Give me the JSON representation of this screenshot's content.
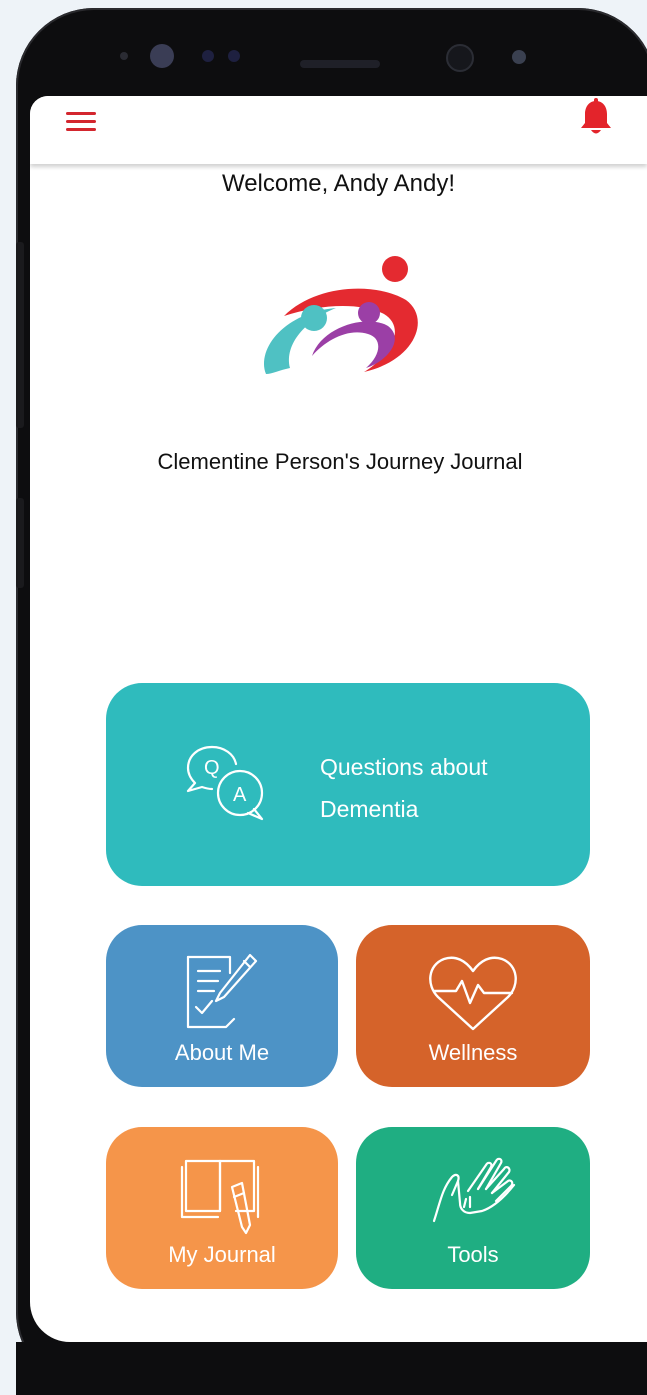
{
  "header": {
    "menu_icon": "hamburger-menu-icon",
    "notification_icon": "bell-icon",
    "accent_color": "#d3262e"
  },
  "welcome": {
    "text": "Welcome, Andy Andy!"
  },
  "logo": {
    "icon": "family-logo-icon",
    "colors": [
      "#e42a30",
      "#9b3fa6",
      "#4fc1c3"
    ]
  },
  "journal": {
    "title": "Clementine Person's Journey Journal"
  },
  "tiles": [
    {
      "id": "questions",
      "line1": "Questions about",
      "line2": "Dementia",
      "icon": "qa-chat-icon",
      "color": "#2fbbbd"
    },
    {
      "id": "about_me",
      "label": "About Me",
      "icon": "document-pen-icon",
      "color": "#4d93c6"
    },
    {
      "id": "wellness",
      "label": "Wellness",
      "icon": "heart-pulse-icon",
      "color": "#d5632a"
    },
    {
      "id": "my_journal",
      "label": "My Journal",
      "icon": "open-book-pen-icon",
      "color": "#f5954a"
    },
    {
      "id": "tools",
      "label": "Tools",
      "icon": "helping-hands-icon",
      "color": "#1fae82"
    }
  ]
}
